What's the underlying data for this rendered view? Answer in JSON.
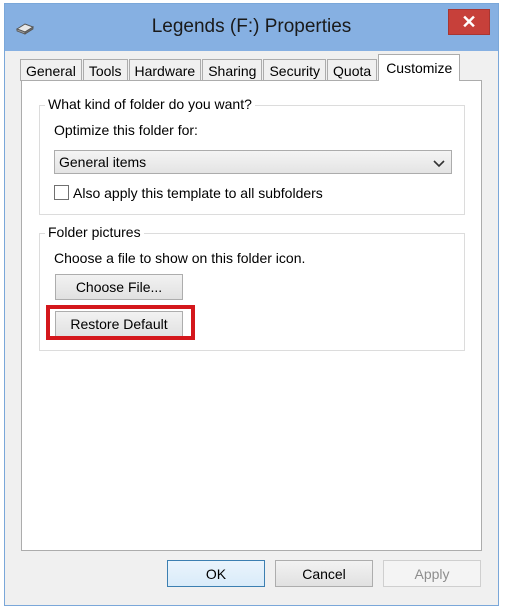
{
  "window": {
    "title": "Legends (F:) Properties",
    "close_glyph": "✕"
  },
  "tabs": [
    {
      "label": "General"
    },
    {
      "label": "Tools"
    },
    {
      "label": "Hardware"
    },
    {
      "label": "Sharing"
    },
    {
      "label": "Security"
    },
    {
      "label": "Quota"
    },
    {
      "label": "Customize",
      "active": true
    }
  ],
  "folder_type": {
    "group_label": "What kind of folder do you want?",
    "optimize_label": "Optimize this folder for:",
    "selected": "General items",
    "apply_label": "Also apply this template to all subfolders",
    "apply_checked": false
  },
  "folder_pictures": {
    "group_label": "Folder pictures",
    "description": "Choose a file to show on this folder icon.",
    "choose_label": "Choose File...",
    "restore_label": "Restore Default"
  },
  "buttons": {
    "ok": "OK",
    "cancel": "Cancel",
    "apply": "Apply"
  },
  "colors": {
    "titlebar": "#86b0e2",
    "close": "#c7403a",
    "highlight": "#d4171c"
  }
}
